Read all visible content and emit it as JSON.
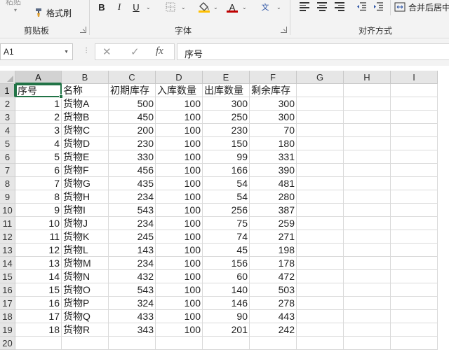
{
  "ribbon": {
    "paste_label": "粘贴",
    "format_painter_label": "格式刷",
    "clipboard_group": "剪贴板",
    "font_group": "字体",
    "alignment_group": "对齐方式",
    "bold": "B",
    "italic": "I",
    "underline": "U",
    "font_color_glyph": "A",
    "phonetic_glyph": "文",
    "merge_label": "合并后居中"
  },
  "formula_bar": {
    "name_box": "A1",
    "cancel_glyph": "✕",
    "enter_glyph": "✓",
    "fx_glyph": "fx",
    "formula": "序号"
  },
  "grid": {
    "columns": [
      "A",
      "B",
      "C",
      "D",
      "E",
      "F",
      "G",
      "H",
      "I"
    ],
    "rows": [
      [
        "序号",
        "名称",
        "初期库存",
        "入库数量",
        "出库数量",
        "剩余库存"
      ],
      [
        "1",
        "货物A",
        "500",
        "100",
        "300",
        "300"
      ],
      [
        "2",
        "货物B",
        "450",
        "100",
        "250",
        "300"
      ],
      [
        "3",
        "货物C",
        "200",
        "100",
        "230",
        "70"
      ],
      [
        "4",
        "货物D",
        "230",
        "100",
        "150",
        "180"
      ],
      [
        "5",
        "货物E",
        "330",
        "100",
        "99",
        "331"
      ],
      [
        "6",
        "货物F",
        "456",
        "100",
        "166",
        "390"
      ],
      [
        "7",
        "货物G",
        "435",
        "100",
        "54",
        "481"
      ],
      [
        "8",
        "货物H",
        "234",
        "100",
        "54",
        "280"
      ],
      [
        "9",
        "货物I",
        "543",
        "100",
        "256",
        "387"
      ],
      [
        "10",
        "货物J",
        "234",
        "100",
        "75",
        "259"
      ],
      [
        "11",
        "货物K",
        "245",
        "100",
        "74",
        "271"
      ],
      [
        "12",
        "货物L",
        "143",
        "100",
        "45",
        "198"
      ],
      [
        "13",
        "货物M",
        "234",
        "100",
        "156",
        "178"
      ],
      [
        "14",
        "货物N",
        "432",
        "100",
        "60",
        "472"
      ],
      [
        "15",
        "货物O",
        "543",
        "100",
        "140",
        "503"
      ],
      [
        "16",
        "货物P",
        "324",
        "100",
        "146",
        "278"
      ],
      [
        "17",
        "货物Q",
        "433",
        "100",
        "90",
        "443"
      ],
      [
        "18",
        "货物R",
        "343",
        "100",
        "201",
        "242"
      ],
      [
        "",
        "",
        "",
        "",
        "",
        ""
      ]
    ],
    "active_cell": "A1",
    "colors": {
      "accent": "#217346",
      "header_bg": "#e6e6e6",
      "grid_line": "#dadada"
    }
  }
}
